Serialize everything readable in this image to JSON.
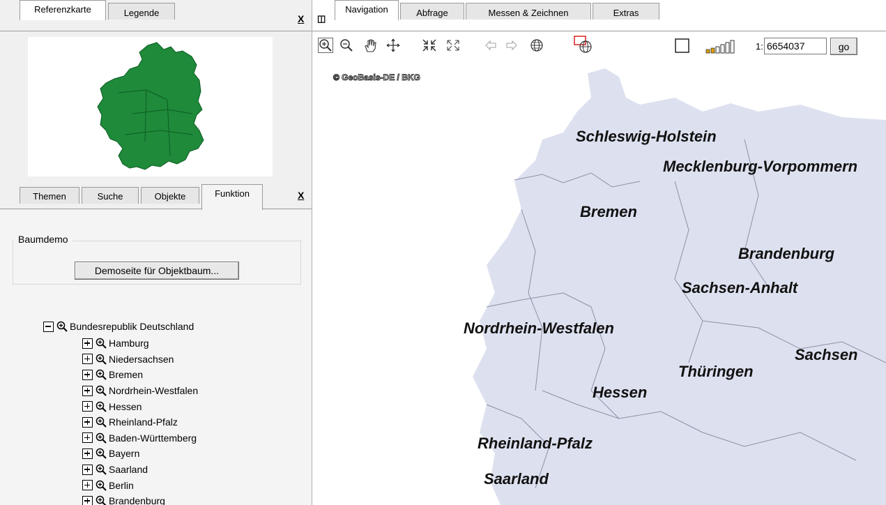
{
  "left_top_tabs": [
    "Referenzkarte",
    "Legende"
  ],
  "left_bottom_tabs": [
    "Themen",
    "Suche",
    "Objekte",
    "Funktion"
  ],
  "close_glyph": "X",
  "function_group": {
    "legend": "Baumdemo",
    "button_label": "Demoseite für Objektbaum..."
  },
  "tree": {
    "root": "Bundesrepublik Deutschland",
    "children": [
      "Hamburg",
      "Niedersachsen",
      "Bremen",
      "Nordrhein-Westfalen",
      "Hessen",
      "Rheinland-Pfalz",
      "Baden-Württemberg",
      "Bayern",
      "Saarland",
      "Berlin",
      "Brandenburg"
    ]
  },
  "main_tabs": [
    "Navigation",
    "Abfrage",
    "Messen & Zeichnen",
    "Extras"
  ],
  "toolbar": {
    "icons": [
      "zoom-in-icon",
      "zoom-out-icon",
      "pan-hand-icon",
      "move-icon",
      "zoom-collapse-icon",
      "zoom-full-extent-icon",
      "back-arrow-icon",
      "forward-arrow-icon",
      "globe-icon",
      "globe-select-icon",
      "checkbox-icon",
      "scale-bars-icon"
    ],
    "scale_prefix": "1:",
    "scale_value": "6654037",
    "go_label": "go"
  },
  "map": {
    "copyright": "© GeoBasis-DE / BKG",
    "labels": [
      "Schleswig-Holstein",
      "Mecklenburg-Vorpommern",
      "Bremen",
      "Brandenburg",
      "Sachsen-Anhalt",
      "Nordrhein-Westfalen",
      "Sachsen",
      "Thüringen",
      "Hessen",
      "Rheinland-Pfalz",
      "Saarland"
    ],
    "land_color": "#dde1ef",
    "border_color": "#8a8fa6"
  },
  "refmap_color": "#1e8a3a"
}
